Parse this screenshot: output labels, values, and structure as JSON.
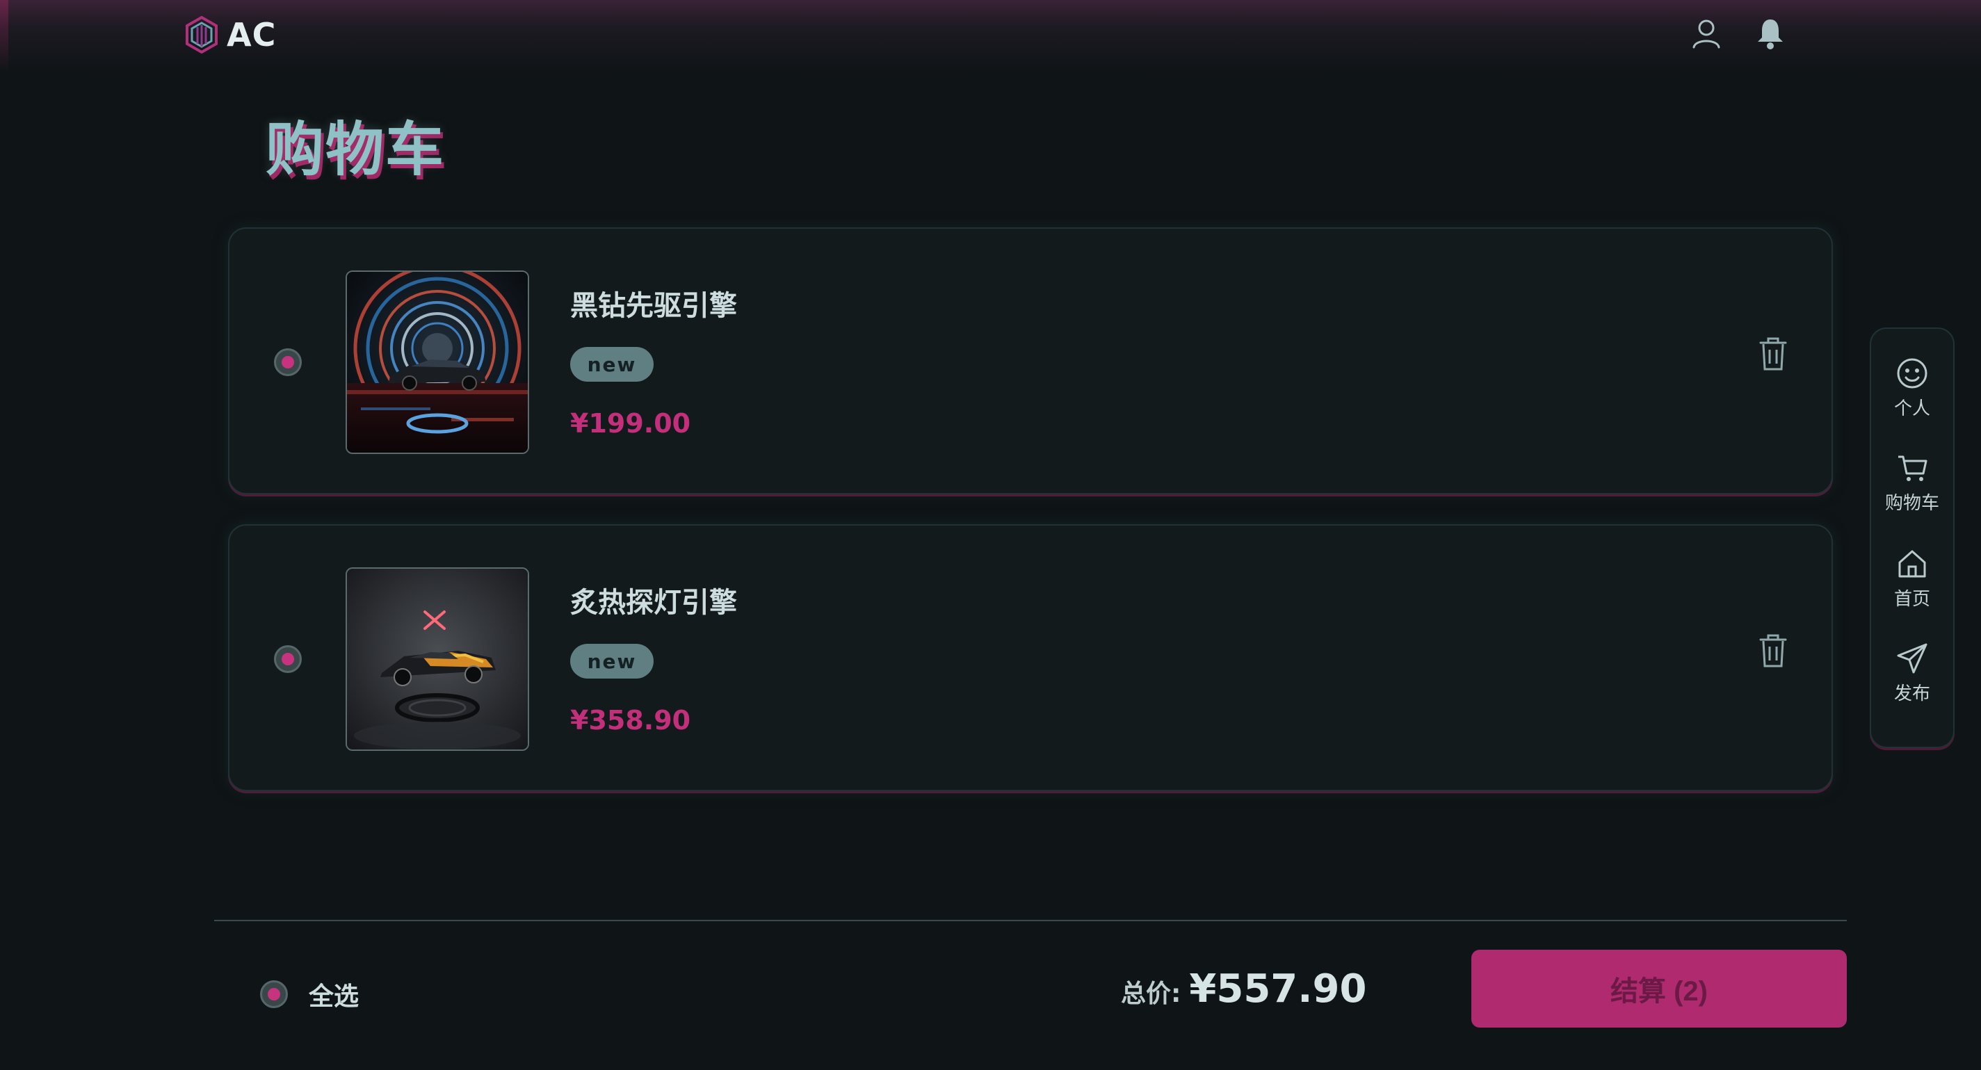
{
  "header": {
    "logo_text": "AC",
    "icons": [
      "user-icon",
      "bell-icon"
    ]
  },
  "page": {
    "title": "购物车"
  },
  "cart": {
    "items": [
      {
        "name": "黑钻先驱引擎",
        "badge": "new",
        "price": "¥199.00",
        "selected": true,
        "image": "car-in-neon-ring-tunnel"
      },
      {
        "name": "炙热探灯引擎",
        "badge": "new",
        "price": "¥358.90",
        "selected": true,
        "image": "car-on-dark-stage-with-x-light"
      }
    ]
  },
  "footer": {
    "select_all_label": "全选",
    "total_label": "总价:",
    "total_value": "¥557.90",
    "checkout_label": "结算 (2)"
  },
  "sidenav": {
    "items": [
      {
        "label": "个人",
        "icon": "smile-face-icon"
      },
      {
        "label": "购物车",
        "icon": "cart-icon"
      },
      {
        "label": "首页",
        "icon": "home-icon"
      },
      {
        "label": "发布",
        "icon": "send-icon"
      }
    ]
  },
  "colors": {
    "accent": "#c42f7b",
    "checkout_bg": "#b02a70",
    "teal": "#8fc2c7",
    "background": "#0f1416",
    "card": "#131a1c"
  }
}
